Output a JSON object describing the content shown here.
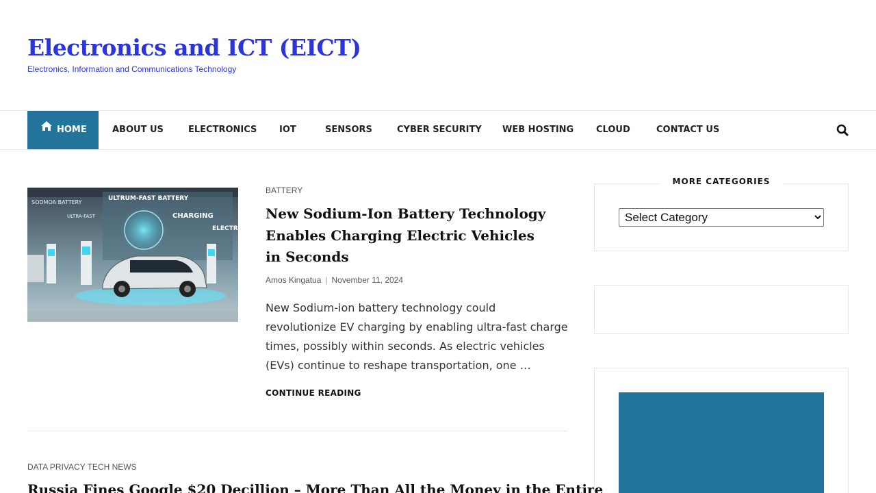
{
  "site": {
    "title": "Electronics and ICT (EICT)",
    "description": "Electronics, Information and Communications Technology"
  },
  "nav": {
    "items": [
      {
        "label": "Home",
        "icon": "home-icon",
        "active": true
      },
      {
        "label": "About Us"
      },
      {
        "label": "Electronics"
      },
      {
        "label": "IOT"
      },
      {
        "label": "Sensors"
      },
      {
        "label": "Cyber Security"
      },
      {
        "label": "Web Hosting"
      },
      {
        "label": "Cloud"
      },
      {
        "label": "Contact Us"
      }
    ],
    "search_icon": "search-icon",
    "accent_color": "#23749a"
  },
  "posts": [
    {
      "category": "Battery",
      "title": "New Sodium-Ion Battery Technology Enables Charging Electric Vehicles in Seconds",
      "author": "Amos Kingatua",
      "date": "November 11, 2024",
      "excerpt": "New Sodium-ion battery technology could revolutionize EV charging by enabling ultra-fast charge times, possibly within seconds. As electric vehicles (EVs) continue to reshape transportation, one …",
      "continue_label": "Continue Reading",
      "image_texts": {
        "a": "SODMOA BATTERY",
        "b": "ULTRUM-FAST BATTERY",
        "c": "CHARGING",
        "d": "ULTRA-FAST",
        "e": "ELECTR VEHICL"
      }
    },
    {
      "category": "Data Privacy Tech News",
      "title": "Russia Fines Google $20 Decillion – More Than All the Money in the Entire"
    }
  ],
  "sidebar": {
    "categories_title": "More Categories",
    "select_placeholder": "Select Category"
  }
}
